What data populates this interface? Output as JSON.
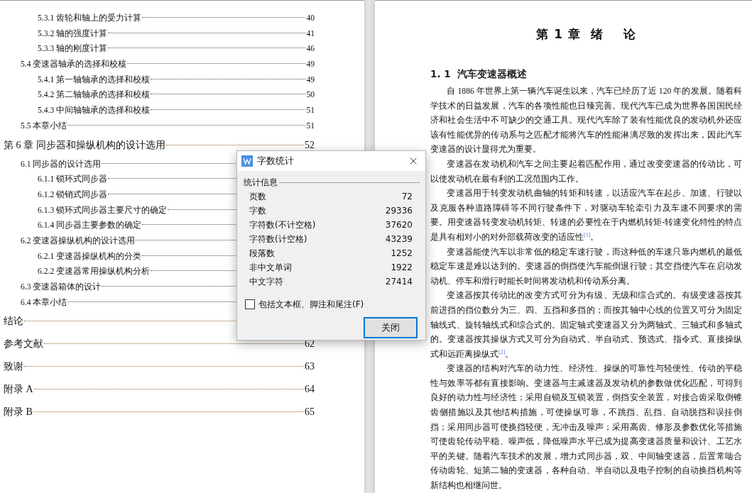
{
  "toc": [
    {
      "kind": "subsection",
      "title": "5.3.1 齿轮和轴上的受力计算",
      "page": "40"
    },
    {
      "kind": "subsection",
      "title": "5.3.2  轴的强度计算",
      "page": "41"
    },
    {
      "kind": "subsection",
      "title": "5.3.3  轴的刚度计算",
      "page": "46"
    },
    {
      "kind": "section",
      "title": "5.4 变速器轴承的选择和校核",
      "page": "49"
    },
    {
      "kind": "subsection",
      "title": "5.4.1  第一轴轴承的选择和校核",
      "page": "49"
    },
    {
      "kind": "subsection",
      "title": "5.4.2  第二轴轴承的选择和校核",
      "page": "50"
    },
    {
      "kind": "subsection",
      "title": "5.4.3  中间轴轴承的选择和校核",
      "page": "51"
    },
    {
      "kind": "section",
      "title": "5.5  本章小结",
      "page": "51"
    },
    {
      "kind": "chapter",
      "title": "第 6 章  同步器和操纵机构的设计选用",
      "page": "52"
    },
    {
      "kind": "section",
      "title": "6.1  同步器的设计选用"
    },
    {
      "kind": "subsection",
      "title": "6.1.1  锁环式同步器"
    },
    {
      "kind": "subsection",
      "title": "6.1.2  锁销式同步器"
    },
    {
      "kind": "subsection",
      "title": "6.1.3  锁环式同步器主要尺寸的确定"
    },
    {
      "kind": "subsection",
      "title": "6.1.4  同步器主要参数的确定"
    },
    {
      "kind": "section",
      "title": "6.2  变速器操纵机构的设计选用"
    },
    {
      "kind": "subsection",
      "title": "6.2.1  变速器操纵机构的分类"
    },
    {
      "kind": "subsection",
      "title": "6.2.2  变速器常用操纵机构分析"
    },
    {
      "kind": "section",
      "title": "6.3  变速器箱体的设计"
    },
    {
      "kind": "section",
      "title": "6.4  本章小结"
    },
    {
      "kind": "chapter",
      "title": "结论"
    },
    {
      "kind": "chapter",
      "title": "参考文献",
      "page": "62"
    },
    {
      "kind": "chapter",
      "title": "致谢",
      "page": "63"
    },
    {
      "kind": "chapter",
      "title": "附录 A",
      "page": "64"
    },
    {
      "kind": "chapter",
      "title": "附录 B",
      "page": "65"
    }
  ],
  "chapter_heading": "第 1 章  绪    论",
  "section_heading": "1. 1  汽车变速器概述",
  "paragraphs": [
    "自 1886 年世界上第一辆汽车诞生以来，汽车已经历了近 120 年的发展。随着科学技术的日益发展，汽车的各项性能也日臻完善。现代汽车已成为世界各国国民经济和社会生活中不可缺少的交通工具。现代汽车除了装有性能优良的发动机外还应该有性能优异的传动系与之匹配才能将汽车的性能淋漓尽致的发挥出来，因此汽车变速器的设计显得尤为重要。",
    "变速器在发动机和汽车之间主要起着匹配作用，通过改变变速器的传动比，可以使发动机在最有利的工况范围内工作。",
    "变速器用于转变发动机曲轴的转矩和转速，以适应汽车在起步、加速、行驶以及克服各种道路障碍等不同行驶条件下，对驱动车轮牵引力及车速不同要求的需要。用变速器转变发动机转矩、转速的必要性在于内燃机转矩-转速变化特性的特点是具有相对小的对外部载荷改变的适应性$^{[1]}$。",
    "变速器能使汽车以非常低的稳定车速行驶，而这种低的车速只靠内燃机的最低稳定车速是难以达到的。变速器的倒挡使汽车能倒退行驶；其空挡使汽车在启动发动机、停车和滑行时能长时间将发动机和传动系分离。",
    "变速器按其传动比的改变方式可分为有级、无级和综合式的。有级变速器按其前进挡的挡位数分为三、四、五挡和多挡的；而按其轴中心线的位置又可分为固定轴线式、旋转轴线式和综合式的。固定轴式变速器又分为两轴式、三轴式和多轴式的。变速器按其操纵方式又可分为自动式、半自动式、预选式、指令式、直接操纵式和远距离操纵式$^{[2]}$。",
    "变速器的结构对汽车的动力性、经济性、操纵的可靠性与轻便性、传动的平稳性与效率等都有直接影响。变速器与主减速器及发动机的参数做优化匹配，可得到良好的动力性与经济性；采用自锁及互锁装置，倒挡安全装置，对接合齿采取倒锥齿侧措施以及其他结构措施，可使操纵可靠，不跳挡、乱挡、自动脱挡和误挂倒挡；采用同步器可使换挡轻便，无冲击及噪声；采用高齿、修形及参数优化等措施可使齿轮传动平稳、噪声低，降低噪声水平已成为提高变速器质量和设计、工艺水平的关键。随着汽车技术的发展，增力式同步器，双、中间轴变速器，后置常啮合传动齿轮、短第二轴的变速器，各种自动、半自动以及电子控制的自动换挡机构等新结构也相继问世。"
  ],
  "dialog": {
    "title": "字数统计",
    "group": "统计信息",
    "stats": [
      {
        "label": "页数",
        "value": "72"
      },
      {
        "label": "字数",
        "value": "29336"
      },
      {
        "label": "字符数(不计空格)",
        "value": "37620"
      },
      {
        "label": "字符数(计空格)",
        "value": "43239"
      },
      {
        "label": "段落数",
        "value": "1252"
      },
      {
        "label": "非中文单词",
        "value": "1922"
      },
      {
        "label": "中文字符",
        "value": "27414"
      }
    ],
    "include_checkbox": {
      "label": "包括文本框、脚注和尾注(F)",
      "checked": false
    },
    "close_button": "关闭"
  }
}
